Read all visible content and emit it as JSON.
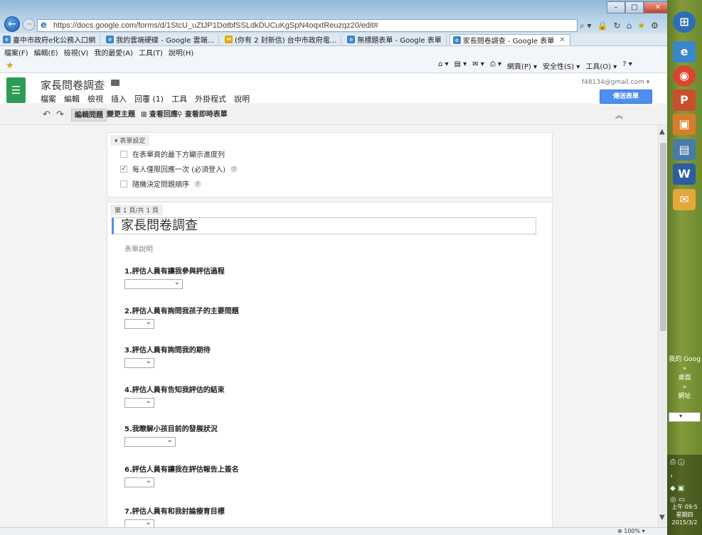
{
  "browser": {
    "url": "https://docs.google.com/forms/d/1StcU_uZtJP1DotbfSSLdkDUCuKgSpN4oqxtReuzqz20/edit#",
    "tabs": [
      {
        "label": "臺中市政府e化公務入口網",
        "active": false
      },
      {
        "label": "我的雲端硬碟 - Google 雲端...",
        "active": false
      },
      {
        "label": "(你有 2 封新信) 台中市政府電...",
        "active": false
      },
      {
        "label": "無標題表單 - Google 表單",
        "active": false
      },
      {
        "label": "家長問卷調查 - Google 表單",
        "active": true
      }
    ],
    "menu": [
      "檔案(F)",
      "編輯(E)",
      "檢視(V)",
      "我的最愛(A)",
      "工具(T)",
      "說明(H)"
    ],
    "commands": [
      "網頁(P) ▾",
      "安全性(S) ▾",
      "工具(O) ▾"
    ],
    "zoom": "100%"
  },
  "gforms": {
    "doc_title": "家長問卷調查",
    "menu": [
      "檔案",
      "編輯",
      "檢視",
      "插入",
      "回覆 (1)",
      "工具",
      "外掛程式",
      "說明"
    ],
    "account": "f48134@gmail.com",
    "send_label": "傳送表單",
    "toolbar": {
      "edit": "編輯問題",
      "theme": "變更主題",
      "responses": "查看回應",
      "live": "查看即時表單"
    }
  },
  "settings": {
    "tag": "表單設定",
    "items": [
      {
        "label": "在表單頁的最下方顯示進度列",
        "checked": false,
        "help": false
      },
      {
        "label": "每人僅限回應一次 (必須登入)",
        "checked": true,
        "help": true
      },
      {
        "label": "隨機決定問題順序",
        "checked": false,
        "help": true
      }
    ]
  },
  "form": {
    "page_tag": "第 1 頁/共 1 頁",
    "title": "家長問卷調查",
    "description": "表單說明",
    "questions": [
      {
        "title": "1.評估人員有讓我參與評估過程"
      },
      {
        "title": "2.評估人員有詢問我孩子的主要問題"
      },
      {
        "title": "3.評估人員有詢問我的期待"
      },
      {
        "title": "4.評估人員有告知我評估的結束"
      },
      {
        "title": "5.我瞭解小孩目前的發展狀況"
      },
      {
        "title": "6.評估人員有讓我在評估報告上簽名"
      },
      {
        "title": "7.評估人員有和我討論療育目標"
      }
    ]
  },
  "desktop": {
    "gadget_text": [
      "我的 Goog",
      "»",
      "桌面",
      "»",
      "網址"
    ],
    "clock": [
      "上午 09:5",
      "星期四",
      "2015/3/2"
    ]
  }
}
